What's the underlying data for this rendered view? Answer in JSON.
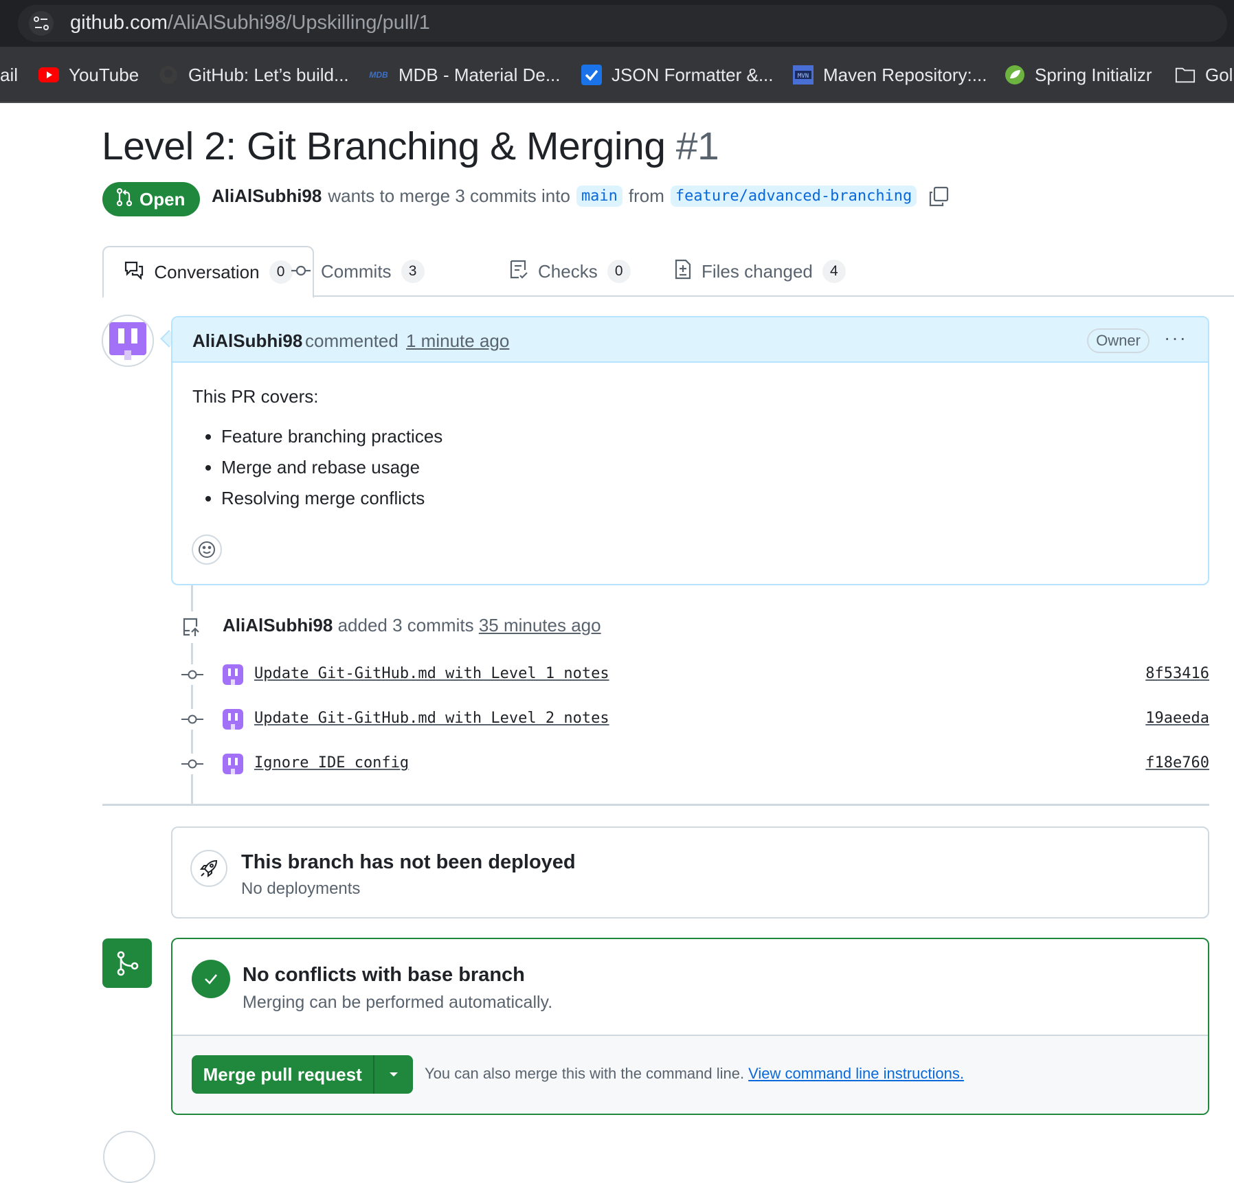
{
  "browser": {
    "url_domain": "github.com",
    "url_path": "/AliAlSubhi98/Upskilling/pull/1",
    "bookmarks": [
      {
        "label": "ail",
        "icon": "none"
      },
      {
        "label": "YouTube",
        "icon": "youtube-icon"
      },
      {
        "label": "GitHub: Let’s build...",
        "icon": "github-icon"
      },
      {
        "label": "MDB - Material De...",
        "icon": "mdb-icon"
      },
      {
        "label": "JSON Formatter &...",
        "icon": "json-formatter-icon"
      },
      {
        "label": "Maven Repository:...",
        "icon": "maven-icon"
      },
      {
        "label": "Spring Initializr",
        "icon": "spring-icon"
      },
      {
        "label": "Gol",
        "icon": "folder-icon"
      }
    ]
  },
  "pr": {
    "title": "Level 2: Git Branching & Merging",
    "number": "#1",
    "state": "Open",
    "author": "AliAlSubhi98",
    "merge_text": "wants to merge 3 commits into",
    "base_branch": "main",
    "from_text": "from",
    "head_branch": "feature/advanced-branching"
  },
  "tabs": [
    {
      "label": "Conversation",
      "count": "0",
      "icon": "comment-discussion-icon"
    },
    {
      "label": "Commits",
      "count": "3",
      "icon": "git-commit-icon"
    },
    {
      "label": "Checks",
      "count": "0",
      "icon": "checklist-icon"
    },
    {
      "label": "Files changed",
      "count": "4",
      "icon": "file-diff-icon"
    }
  ],
  "comment": {
    "author": "AliAlSubhi98",
    "action": "commented",
    "time": "1 minute ago",
    "role": "Owner",
    "menu": "···",
    "intro": "This PR covers:",
    "items": [
      "Feature branching practices",
      "Merge and rebase usage",
      "Resolving merge conflicts"
    ]
  },
  "push_event": {
    "author": "AliAlSubhi98",
    "action": "added 3 commits",
    "time": "35 minutes ago"
  },
  "commits": [
    {
      "message": "Update Git-GitHub.md with Level 1 notes",
      "sha": "8f53416"
    },
    {
      "message": "Update Git-GitHub.md with Level 2 notes",
      "sha": "19aeeda"
    },
    {
      "message": "Ignore IDE config",
      "sha": "f18e760"
    }
  ],
  "deployment": {
    "title": "This branch has not been deployed",
    "subtitle": "No deployments"
  },
  "merge": {
    "title": "No conflicts with base branch",
    "subtitle": "Merging can be performed automatically.",
    "button": "Merge pull request",
    "note": "You can also merge this with the command line.",
    "link": "View command line instructions."
  },
  "colors": {
    "success": "#1f883d",
    "accent": "#0969da",
    "comment_header": "#ddf4ff",
    "avatar_purple": "#a371f7"
  }
}
